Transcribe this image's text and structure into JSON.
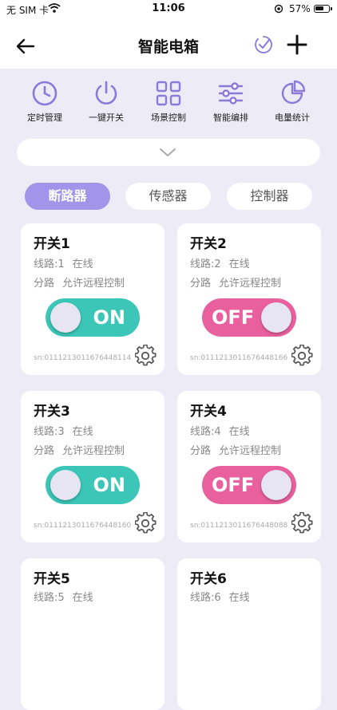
{
  "status_bar": {
    "carrier": "无 SIM 卡",
    "time": "11:06",
    "battery": "57%"
  },
  "header": {
    "title": "智能电箱"
  },
  "icons": {
    "back": "back-arrow-icon",
    "confirm": "check-circle-icon",
    "add": "plus-icon",
    "expand": "chevron-down-icon",
    "settings": "gear-icon"
  },
  "functions": [
    {
      "label": "定时管理",
      "icon": "clock-icon"
    },
    {
      "label": "一键开关",
      "icon": "power-icon"
    },
    {
      "label": "场景控制",
      "icon": "scene-grid-icon"
    },
    {
      "label": "智能编排",
      "icon": "sliders-icon"
    },
    {
      "label": "电量统计",
      "icon": "pie-chart-icon"
    }
  ],
  "tabs": [
    {
      "label": "断路器",
      "active": true
    },
    {
      "label": "传感器",
      "active": false
    },
    {
      "label": "控制器",
      "active": false
    }
  ],
  "colors": {
    "accent": "#8b7ad8",
    "tab_active": "#a194e9",
    "on": "#3bc6b8",
    "off": "#e8609e",
    "background": "#ecebf6"
  },
  "switches": [
    {
      "name": "开关1",
      "line_label": "线路:1",
      "online": "在线",
      "type": "分路",
      "remote": "允许远程控制",
      "state": "ON",
      "sn": "sn:0111213011676448114"
    },
    {
      "name": "开关2",
      "line_label": "线路:2",
      "online": "在线",
      "type": "分路",
      "remote": "允许远程控制",
      "state": "OFF",
      "sn": "sn:0111213011676448166"
    },
    {
      "name": "开关3",
      "line_label": "线路:3",
      "online": "在线",
      "type": "分路",
      "remote": "允许远程控制",
      "state": "ON",
      "sn": "sn:0111213011676448160"
    },
    {
      "name": "开关4",
      "line_label": "线路:4",
      "online": "在线",
      "type": "分路",
      "remote": "允许远程控制",
      "state": "OFF",
      "sn": "sn:0111213011676448088"
    },
    {
      "name": "开关5",
      "line_label": "线路:5",
      "online": "在线"
    },
    {
      "name": "开关6",
      "line_label": "线路:6",
      "online": "在线"
    }
  ]
}
